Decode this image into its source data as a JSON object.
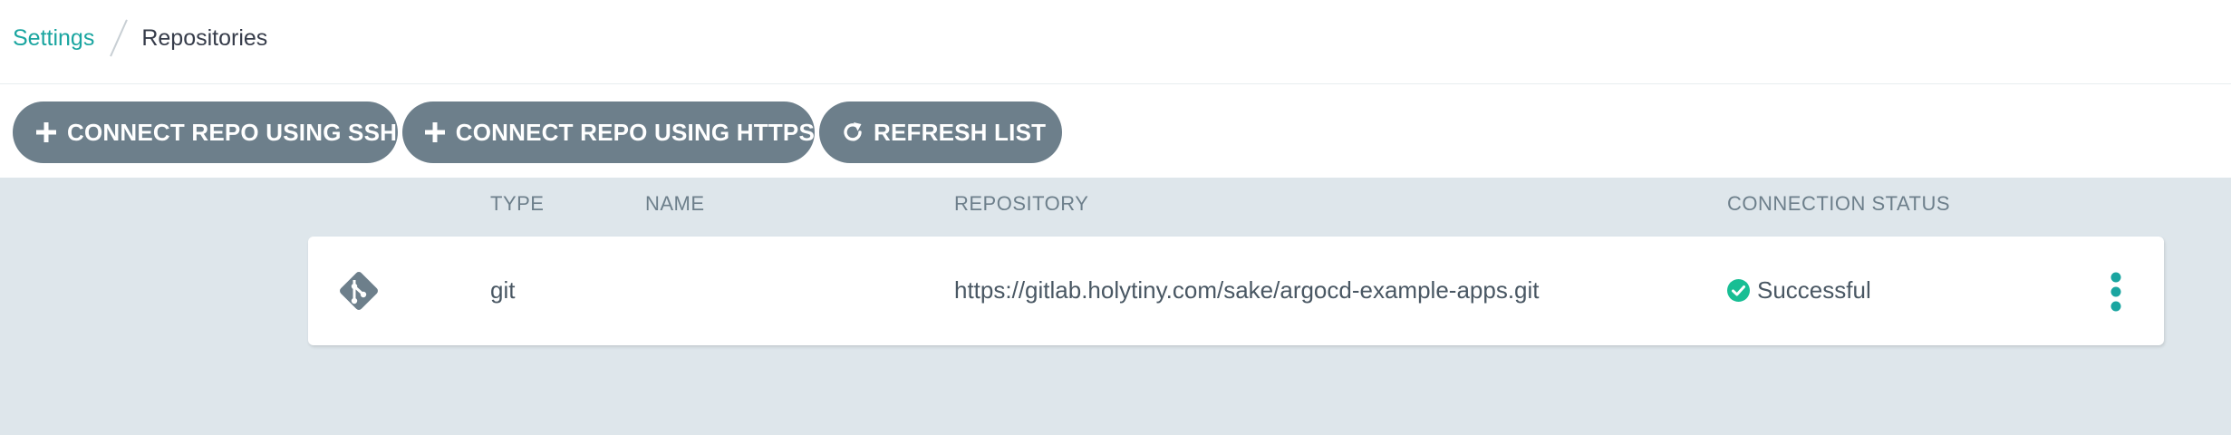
{
  "breadcrumb": {
    "parent": "Settings",
    "current": "Repositories"
  },
  "toolbar": {
    "connect_ssh_label": "CONNECT REPO USING SSH",
    "connect_https_label": "CONNECT REPO USING HTTPS",
    "refresh_label": "REFRESH LIST"
  },
  "table": {
    "columns": [
      "TYPE",
      "NAME",
      "REPOSITORY",
      "CONNECTION STATUS"
    ],
    "rows": [
      {
        "icon": "git-icon",
        "type": "git",
        "name": "",
        "repository": "https://gitlab.holytiny.com/sake/argocd-example-apps.git",
        "status": "Successful",
        "status_icon": "check-circle-icon"
      }
    ]
  },
  "colors": {
    "accent": "#1aa5a0",
    "button_bg": "#6d7f8b",
    "status_success": "#18be94",
    "content_bg": "#dee6eb"
  }
}
